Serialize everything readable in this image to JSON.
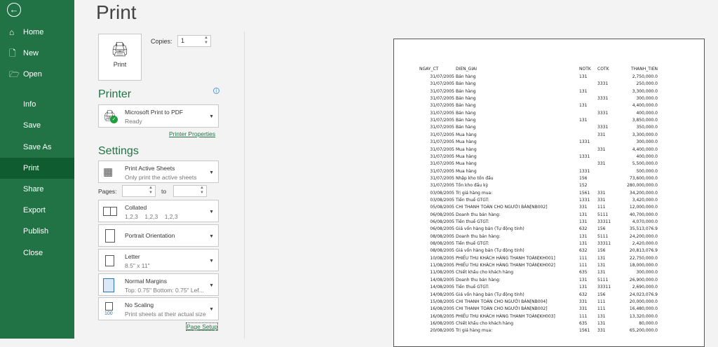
{
  "nav": {
    "items": [
      {
        "label": "Home",
        "icon": "home-icon"
      },
      {
        "label": "New",
        "icon": "new-icon"
      },
      {
        "label": "Open",
        "icon": "open-icon"
      },
      {
        "label": "Info"
      },
      {
        "label": "Save"
      },
      {
        "label": "Save As"
      },
      {
        "label": "Print",
        "selected": true
      },
      {
        "label": "Share"
      },
      {
        "label": "Export"
      },
      {
        "label": "Publish"
      },
      {
        "label": "Close"
      }
    ]
  },
  "title": "Print",
  "print_button": "Print",
  "copies_label": "Copies:",
  "copies": "1",
  "printer_heading": "Printer",
  "printer": {
    "name": "Microsoft Print to PDF",
    "status": "Ready"
  },
  "printer_properties": "Printer Properties",
  "settings_heading": "Settings",
  "settings": {
    "sheets": {
      "l1": "Print Active Sheets",
      "l2": "Only print the active sheets"
    },
    "pages_label": "Pages:",
    "to_label": "to",
    "pages_from": "",
    "pages_to": "",
    "collated": {
      "l1": "Collated",
      "l2": "1,2,3    1,2,3    1,2,3"
    },
    "orientation": {
      "l1": "Portrait Orientation"
    },
    "paper": {
      "l1": "Letter",
      "l2": "8.5\" x 11\""
    },
    "margins": {
      "l1": "Normal Margins",
      "l2": "Top: 0.75\" Bottom: 0.75\" Lef..."
    },
    "scaling": {
      "l1": "No Scaling",
      "l2": "Print sheets at their actual size",
      "icon_text": "100"
    }
  },
  "page_setup": "Page Setup",
  "preview": {
    "headers": [
      "NGAY_CT",
      "DIEN_GIAI",
      "NOTK",
      "COTK",
      "THANH_TIEN"
    ],
    "rows": [
      [
        "31/07/2005",
        "Bán hàng",
        "131",
        "",
        "2,750,000.0"
      ],
      [
        "31/07/2005",
        "Bán hàng",
        "",
        "3331",
        "250,000.0"
      ],
      [
        "31/07/2005",
        "Bán hàng",
        "131",
        "",
        "3,300,000.0"
      ],
      [
        "31/07/2005",
        "Bán hàng",
        "",
        "3331",
        "300,000.0"
      ],
      [
        "31/07/2005",
        "Bán hàng",
        "131",
        "",
        "4,400,000.0"
      ],
      [
        "31/07/2005",
        "Bán hàng",
        "",
        "3331",
        "400,000.0"
      ],
      [
        "31/07/2005",
        "Bán hàng",
        "131",
        "",
        "3,850,000.0"
      ],
      [
        "31/07/2005",
        "Bán hàng",
        "",
        "3331",
        "350,000.0"
      ],
      [
        "31/07/2005",
        "Mua hàng",
        "",
        "331",
        "3,300,000.0"
      ],
      [
        "31/07/2005",
        "Mua hàng",
        "1331",
        "",
        "300,000.0"
      ],
      [
        "31/07/2005",
        "Mua hàng",
        "",
        "331",
        "4,400,000.0"
      ],
      [
        "31/07/2005",
        "Mua hàng",
        "1331",
        "",
        "400,000.0"
      ],
      [
        "31/07/2005",
        "Mua hàng",
        "",
        "331",
        "5,500,000.0"
      ],
      [
        "31/07/2005",
        "Mua hàng",
        "1331",
        "",
        "500,000.0"
      ],
      [
        "31/07/2005",
        "Nhập kho tồn đầu",
        "156",
        "",
        "73,600,000.0"
      ],
      [
        "31/07/2005",
        "Tồn kho đầu kỳ",
        "152",
        "",
        "280,000,000.0"
      ],
      [
        "03/08/2005",
        "Trị giá hàng mua:",
        "1561",
        "331",
        "34,200,000.0"
      ],
      [
        "03/08/2005",
        "Tiền thuế GTGT:",
        "1331",
        "331",
        "3,420,000.0"
      ],
      [
        "05/08/2005",
        "CHI THANH TOÁN CHO NGƯỜI BÁN[NB002]",
        "331",
        "111",
        "12,000,000.0"
      ],
      [
        "06/08/2005",
        "Doanh thu bán hàng:",
        "131",
        "5111",
        "40,700,000.0"
      ],
      [
        "06/08/2005",
        "Tiền thuế GTGT:",
        "131",
        "33311",
        "4,070,000.0"
      ],
      [
        "06/08/2005",
        "Giá vốn hàng bán  (Tự động tính)",
        "632",
        "156",
        "35,513,076.9"
      ],
      [
        "08/08/2005",
        "Doanh thu bán hàng:",
        "131",
        "5111",
        "24,200,000.0"
      ],
      [
        "08/08/2005",
        "Tiền thuế GTGT:",
        "131",
        "33311",
        "2,420,000.0"
      ],
      [
        "08/08/2005",
        "Giá vốn hàng bán  (Tự động tính)",
        "632",
        "156",
        "20,813,076.9"
      ],
      [
        "10/08/2005",
        "PHIẾU THU KHÁCH HÀNG THANH TOÁN[KH001]",
        "111",
        "131",
        "22,750,000.0"
      ],
      [
        "11/08/2005",
        "PHIẾU THU KHÁCH HÀNG THANH TOÁN[KH002]",
        "111",
        "131",
        "18,000,000.0"
      ],
      [
        "11/08/2005",
        "Chiết khấu cho khách hàng",
        "635",
        "131",
        "300,000.0"
      ],
      [
        "14/08/2005",
        "Doanh thu bán hàng:",
        "131",
        "5111",
        "26,900,000.0"
      ],
      [
        "14/08/2005",
        "Tiền thuế GTGT:",
        "131",
        "33311",
        "2,690,000.0"
      ],
      [
        "14/08/2005",
        "Giá vốn hàng bán  (Tự động tính)",
        "632",
        "156",
        "24,023,076.9"
      ],
      [
        "15/08/2005",
        "CHI THANH TOÁN CHO NGƯỜI BÁN[NB004]",
        "331",
        "111",
        "20,000,000.0"
      ],
      [
        "16/08/2005",
        "CHI THANH TOÁN CHO NGƯỜI BÁN[NB002]",
        "331",
        "111",
        "16,480,000.0"
      ],
      [
        "16/08/2005",
        "PHIẾU THU KHÁCH HÀNG THANH TOÁN[KH003]",
        "111",
        "131",
        "13,320,000.0"
      ],
      [
        "16/08/2005",
        "Chiết khấu cho khách hàng",
        "635",
        "131",
        "80,000.0"
      ],
      [
        "20/08/2005",
        "Trị giá hàng mua:",
        "1561",
        "331",
        "65,200,000.0"
      ]
    ]
  }
}
